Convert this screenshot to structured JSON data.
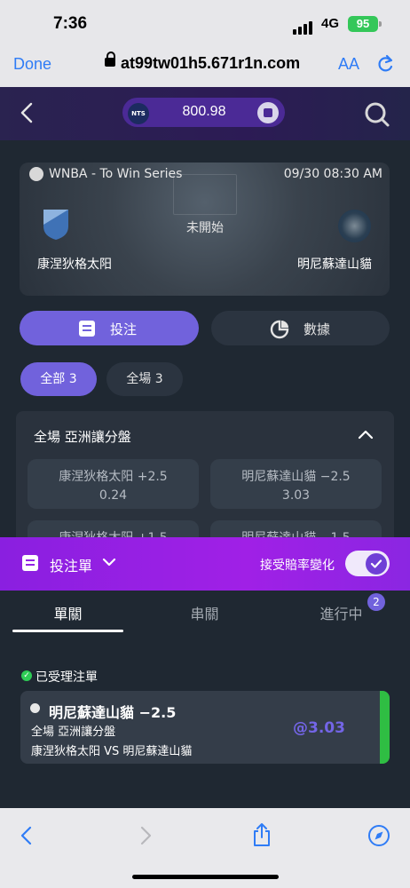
{
  "status": {
    "time": "7:36",
    "network": "4G",
    "battery": "95"
  },
  "browser": {
    "done": "Done",
    "url": "at99tw01h5.671r1n.com",
    "text_size": "AA"
  },
  "header": {
    "currency": "NTS",
    "balance": "800.98"
  },
  "match": {
    "league": "WNBA - To Win Series",
    "datetime": "09/30 08:30 AM",
    "status": "未開始",
    "home": "康涅狄格太阳",
    "away": "明尼蘇達山貓"
  },
  "tabs": {
    "bet": "投注",
    "data": "數據"
  },
  "filters": {
    "all": "全部 3",
    "full": "全場 3"
  },
  "market": {
    "title": "全場 亞洲讓分盤",
    "odds": [
      {
        "name": "康涅狄格太阳 +2.5",
        "value": "0.24"
      },
      {
        "name": "明尼蘇達山貓 −2.5",
        "value": "3.03"
      },
      {
        "name": "康涅狄格太阳 +1.5",
        "value": ""
      },
      {
        "name": "明尼蘇達山貓 −1.5",
        "value": ""
      }
    ]
  },
  "slip": {
    "title": "投注單",
    "accept_label": "接受賠率變化",
    "accept_enabled": true,
    "tabs": {
      "single": "單關",
      "parlay": "串關",
      "in_progress": "進行中"
    },
    "in_progress_count": "2",
    "accepted_label": "已受理注單",
    "ticket": {
      "selection": "明尼蘇達山貓 −2.5",
      "market": "全場 亞洲讓分盤",
      "match": "康涅狄格太阳 VS 明尼蘇達山貓",
      "odds": "@3.03"
    }
  },
  "colors": {
    "accent": "#7162dc",
    "slip_gradient": "#a020e6",
    "success": "#2fbe43",
    "link": "#2f7cf6"
  }
}
